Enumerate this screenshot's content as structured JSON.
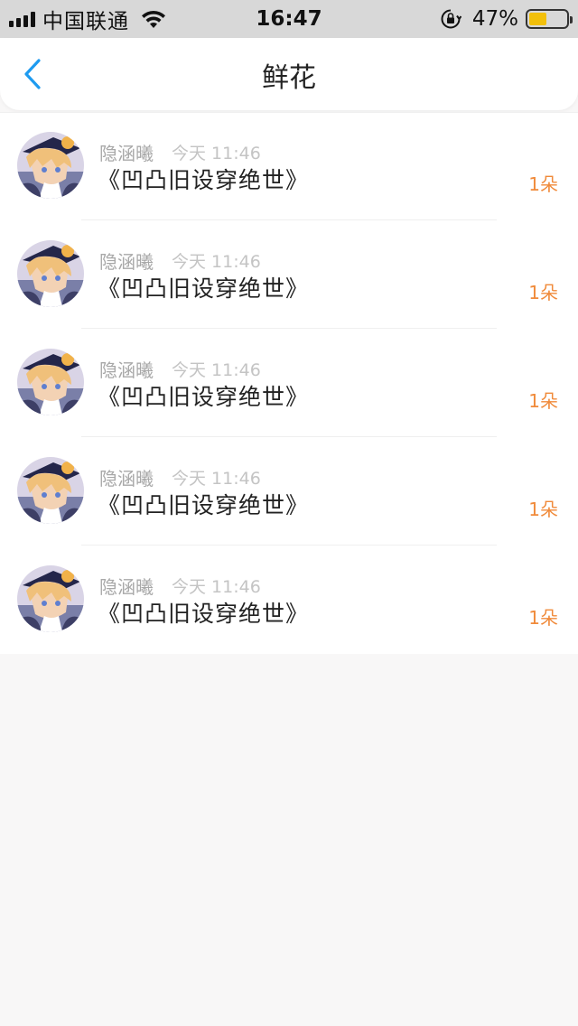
{
  "status_bar": {
    "carrier": "中国联通",
    "time": "16:47",
    "battery_percent": "47%",
    "battery_level": 0.47,
    "battery_color": "#f2c00b",
    "icons": [
      "signal-icon",
      "wifi-icon",
      "orientation-lock-icon",
      "battery-icon"
    ]
  },
  "header": {
    "title": "鲜花",
    "back_icon": "chevron-left-icon",
    "accent_color": "#1e9bf0"
  },
  "gifts": [
    {
      "user": "隐涵曦",
      "time": "今天 11:46",
      "book": "《凹凸旧设穿绝世》",
      "quantity": "1朵"
    },
    {
      "user": "隐涵曦",
      "time": "今天 11:46",
      "book": "《凹凸旧设穿绝世》",
      "quantity": "1朵"
    },
    {
      "user": "隐涵曦",
      "time": "今天 11:46",
      "book": "《凹凸旧设穿绝世》",
      "quantity": "1朵"
    },
    {
      "user": "隐涵曦",
      "time": "今天 11:46",
      "book": "《凹凸旧设穿绝世》",
      "quantity": "1朵"
    },
    {
      "user": "隐涵曦",
      "time": "今天 11:46",
      "book": "《凹凸旧设穿绝世》",
      "quantity": "1朵"
    }
  ],
  "colors": {
    "quantity": "#f08a3a",
    "background": "#f8f7f7"
  }
}
